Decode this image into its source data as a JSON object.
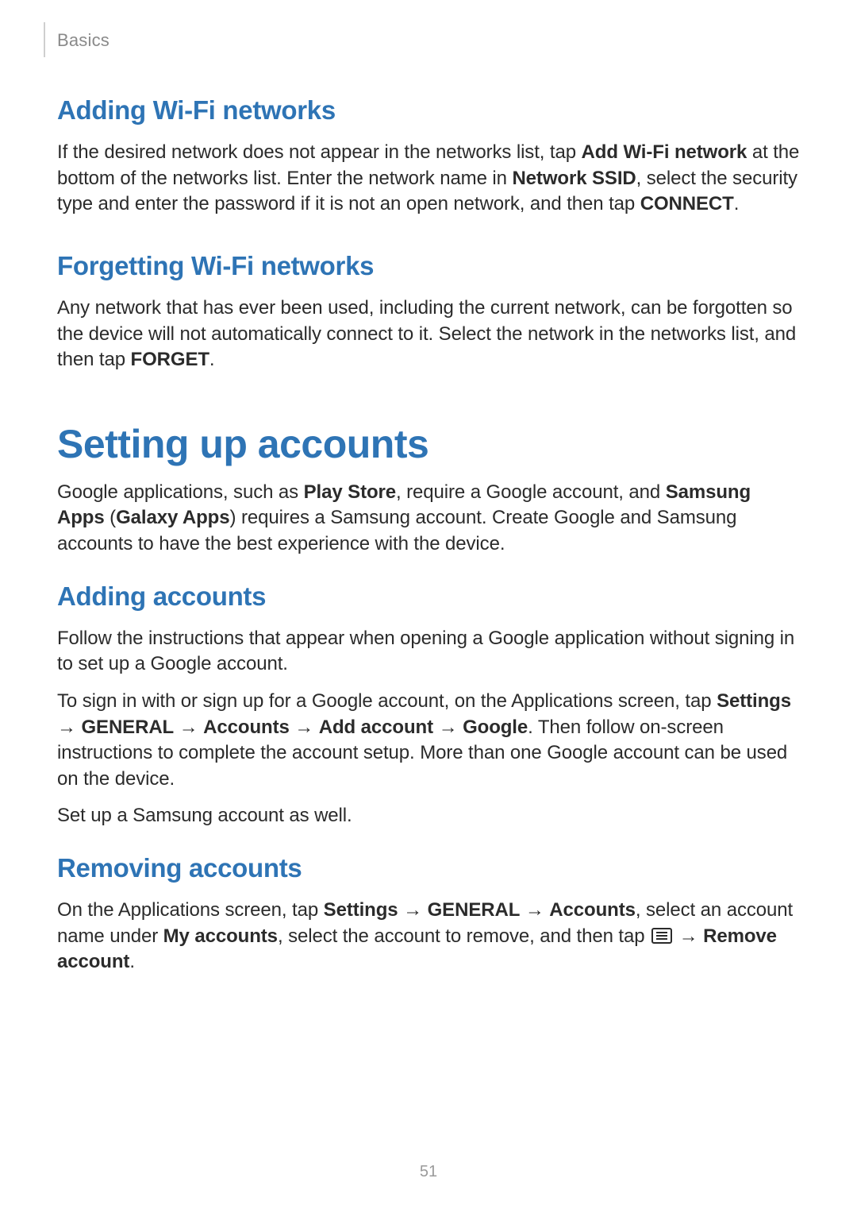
{
  "header": {
    "chapter": "Basics"
  },
  "s1": {
    "title": "Adding Wi-Fi networks",
    "p1a": "If the desired network does not appear in the networks list, tap ",
    "p1b": "Add Wi-Fi network",
    "p1c": " at the bottom of the networks list. Enter the network name in ",
    "p1d": "Network SSID",
    "p1e": ", select the security type and enter the password if it is not an open network, and then tap ",
    "p1f": "CONNECT",
    "p1g": "."
  },
  "s2": {
    "title": "Forgetting Wi-Fi networks",
    "p1a": "Any network that has ever been used, including the current network, can be forgotten so the device will not automatically connect to it. Select the network in the networks list, and then tap ",
    "p1b": "FORGET",
    "p1c": "."
  },
  "s3": {
    "title": "Setting up accounts",
    "p1a": "Google applications, such as ",
    "p1b": "Play Store",
    "p1c": ", require a Google account, and ",
    "p1d": "Samsung Apps",
    "p1e": " (",
    "p1f": "Galaxy Apps",
    "p1g": ") requires a Samsung account. Create Google and Samsung accounts to have the best experience with the device."
  },
  "s4": {
    "title": "Adding accounts",
    "p1": "Follow the instructions that appear when opening a Google application without signing in to set up a Google account.",
    "p2a": "To sign in with or sign up for a Google account, on the Applications screen, tap ",
    "p2b": "Settings",
    "arrow": " → ",
    "p2c": "GENERAL",
    "p2d": "Accounts",
    "p2e": "Add account",
    "p2f": "Google",
    "p2g": ". Then follow on-screen instructions to complete the account setup. More than one Google account can be used on the device.",
    "p3": "Set up a Samsung account as well."
  },
  "s5": {
    "title": "Removing accounts",
    "p1a": "On the Applications screen, tap ",
    "p1b": "Settings",
    "arrow": " → ",
    "p1c": "GENERAL",
    "p1d": "Accounts",
    "p1e": ", select an account name under ",
    "p1f": "My accounts",
    "p1g": ", select the account to remove, and then tap ",
    "p1h": "Remove account",
    "p1i": "."
  },
  "page_number": "51"
}
